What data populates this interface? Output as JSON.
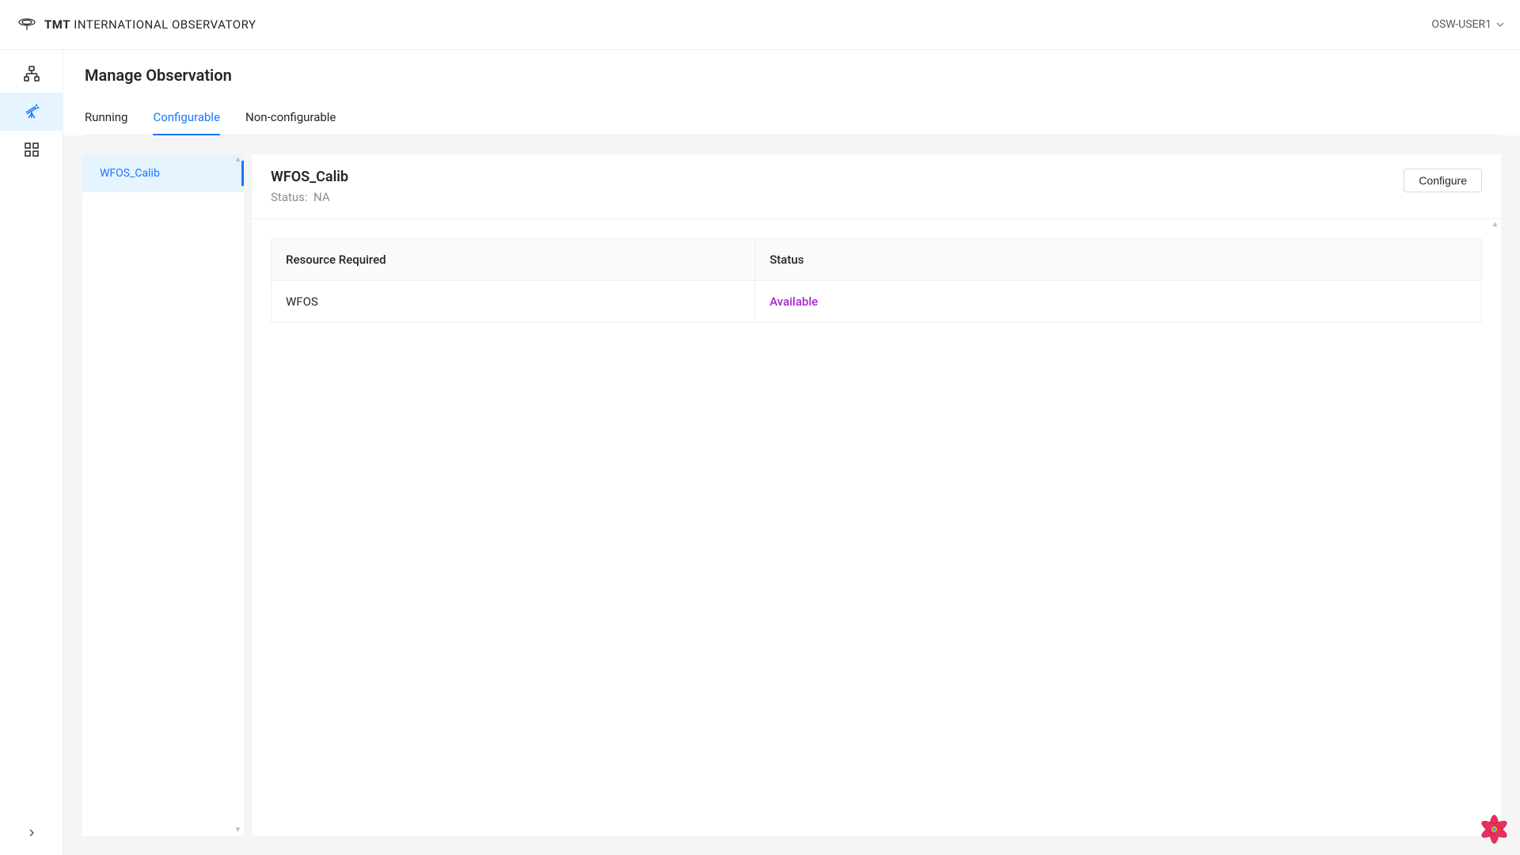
{
  "header": {
    "logo_bold": "TMT",
    "logo_light": " INTERNATIONAL OBSERVATORY",
    "user": "OSW-USER1"
  },
  "sidebar": {
    "items": [
      {
        "name": "infrastructure-icon"
      },
      {
        "name": "observations-icon"
      },
      {
        "name": "resources-icon"
      }
    ]
  },
  "page": {
    "title": "Manage Observation"
  },
  "tabs": [
    {
      "label": "Running",
      "active": false
    },
    {
      "label": "Configurable",
      "active": true
    },
    {
      "label": "Non-configurable",
      "active": false
    }
  ],
  "list": {
    "items": [
      {
        "label": "WFOS_Calib",
        "active": true
      }
    ]
  },
  "detail": {
    "title": "WFOS_Calib",
    "status_label": "Status:",
    "status_value": "NA",
    "configure_button": "Configure"
  },
  "table": {
    "headers": {
      "resource": "Resource Required",
      "status": "Status"
    },
    "rows": [
      {
        "resource": "WFOS",
        "status": "Available",
        "status_class": "status-available"
      }
    ]
  }
}
